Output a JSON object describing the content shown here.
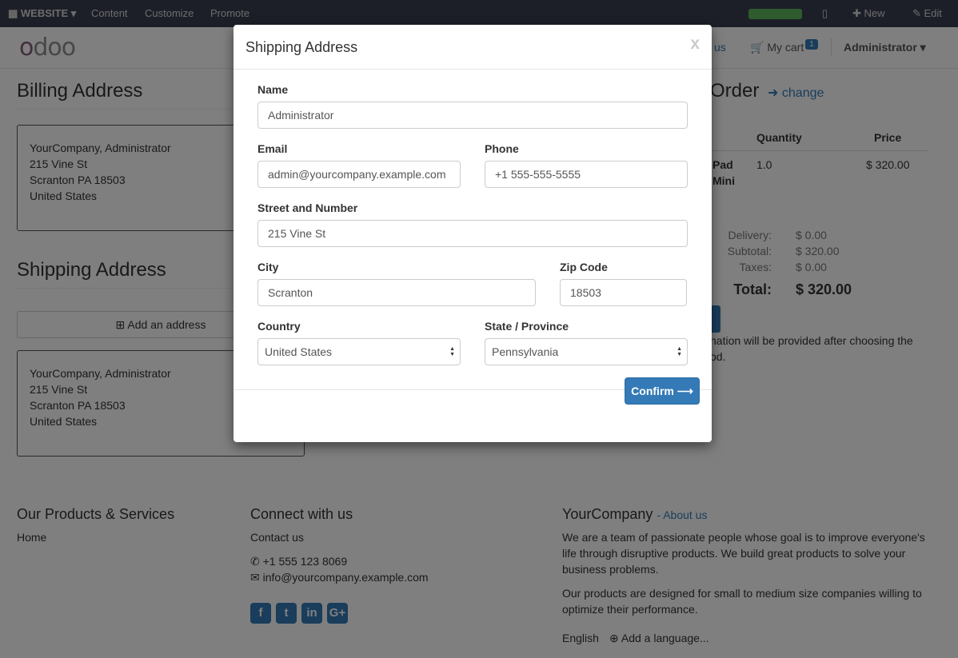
{
  "topbar": {
    "website": "WEBSITE",
    "content": "Content",
    "customize": "Customize",
    "promote": "Promote",
    "new": "New",
    "edit": "Edit"
  },
  "header": {
    "nav_partial": "us",
    "cart_label": "My cart",
    "cart_count": "1",
    "user": "Administrator"
  },
  "billing": {
    "title": "Billing Address",
    "lines": [
      "YourCompany, Administrator",
      "215 Vine St",
      "Scranton PA 18503",
      "United States"
    ]
  },
  "shipping": {
    "title": "Shipping Address",
    "add_label": "Add an address",
    "lines": [
      "YourCompany, Administrator",
      "215 Vine St",
      "Scranton PA 18503",
      "United States"
    ]
  },
  "order": {
    "title_partial": "Order",
    "change": "change",
    "col_quantity": "Quantity",
    "col_price": "Price",
    "product_line1": "Pad",
    "product_line2": "Mini",
    "quantity": "1.0",
    "price": "$ 320.00",
    "delivery_label": "Delivery:",
    "delivery_value": "$ 0.00",
    "subtotal_label": "Subtotal:",
    "subtotal_value": "$ 320.00",
    "taxes_label": "Taxes:",
    "taxes_value": "$ 0.00",
    "total_label": "Total:",
    "total_value": "$ 320.00",
    "note_line1": "nation will be provided after choosing the",
    "note_line2": "od."
  },
  "footer": {
    "products_title": "Our Products & Services",
    "home": "Home",
    "connect_title": "Connect with us",
    "contact": "Contact us",
    "phone": "+1 555 123 8069",
    "email": "info@yourcompany.example.com",
    "company_title": "YourCompany",
    "about": "- About us",
    "about_p1_l1": "We are a team of passionate people whose goal is to improve everyone's",
    "about_p1_l2": "life through disruptive products. We build great products to solve your",
    "about_p1_l3": "business problems.",
    "about_p2_l1": "Our products are designed for small to medium size companies willing to",
    "about_p2_l2": "optimize their performance.",
    "language": "English",
    "add_language": "Add a language..."
  },
  "modal": {
    "title": "Shipping Address",
    "close": "x",
    "name_label": "Name",
    "name_value": "Administrator",
    "email_label": "Email",
    "email_value": "admin@yourcompany.example.com",
    "phone_label": "Phone",
    "phone_value": "+1 555-555-5555",
    "street_label": "Street and Number",
    "street_value": "215 Vine St",
    "city_label": "City",
    "city_value": "Scranton",
    "zip_label": "Zip Code",
    "zip_value": "18503",
    "country_label": "Country",
    "country_value": "United States",
    "state_label": "State / Province",
    "state_value": "Pennsylvania",
    "confirm": "Confirm"
  }
}
